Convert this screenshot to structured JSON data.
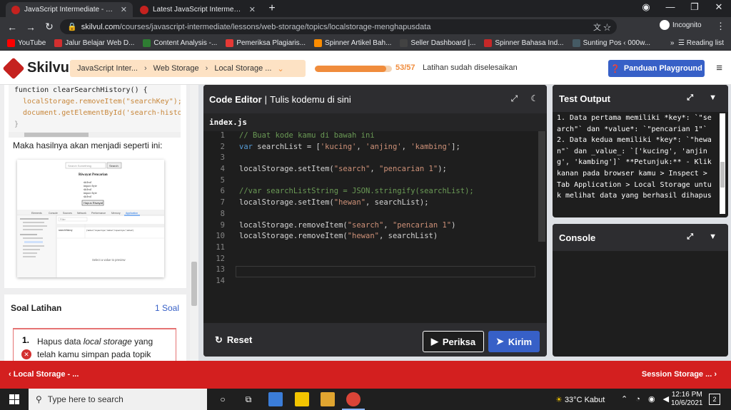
{
  "browser": {
    "tabs": [
      {
        "title": "JavaScript Intermediate - Web St",
        "close": "✕"
      },
      {
        "title": "Latest JavaScript Intermediate to",
        "close": "✕"
      }
    ],
    "new_tab": "+",
    "url_host": "skilvul.com",
    "url_path": "/courses/javascript-intermediate/lessons/web-storage/topics/localstorage-menghapusdata",
    "incognito": "Incognito",
    "bookmarks": [
      {
        "label": "YouTube",
        "color": "#ff0000"
      },
      {
        "label": "Jalur Belajar Web D...",
        "color": "#d32f2f"
      },
      {
        "label": "Content Analysis -...",
        "color": "#2e7d32"
      },
      {
        "label": "Pemeriksa Plagiaris...",
        "color": "#e53935"
      },
      {
        "label": "Spinner Artikel Bah...",
        "color": "#fb8c00"
      },
      {
        "label": "Seller Dashboard |...",
        "color": "#424242"
      },
      {
        "label": "Spinner Bahasa Ind...",
        "color": "#c62828"
      },
      {
        "label": "Sunting Pos ‹ 000w...",
        "color": "#455a64"
      }
    ],
    "bookmarks_more": "»",
    "reading_list": "Reading list"
  },
  "header": {
    "logo": "Skilvul",
    "breadcrumbs": [
      "JavaScript Inter...",
      "Web Storage",
      "Local Storage ..."
    ],
    "progress_fraction": 0.93,
    "progress_count": "53/57",
    "progress_text": "Latihan sudah diselesaikan",
    "guide_button": "Panduan Playground"
  },
  "lesson": {
    "code_lines": [
      "function clearSearchHistory() {",
      "  localStorage.removeItem(\"searchKey\");",
      "  document.getElementById('search-history",
      "}"
    ],
    "result_text": "Maka hasilnya akan menjadi seperti ini:",
    "figure": {
      "search_placeholder": "Search Something",
      "search_button": "Search",
      "history_title": "Riwayat Pencarian",
      "history_items": [
        "skilvul",
        "impact byte",
        "skilvul",
        "impact byte",
        "skilvul"
      ],
      "delete_button": "Hapus Riwayat",
      "devtools_tabs": [
        "Elements",
        "Console",
        "Sources",
        "Network",
        "Performance",
        "Memory",
        "Application"
      ],
      "devtools_filter": "Filter",
      "devtools_key": "searchHistory",
      "devtools_value": "[\"skilvul\",\"impact byte\",\"skilvul\",\"impact byte\",\"skilvul\"]",
      "devtools_select": "Select a value to preview"
    }
  },
  "soal": {
    "title": "Soal Latihan",
    "count": "1 Soal",
    "number": "1.",
    "text_before": "Hapus data ",
    "text_em": "local storage",
    "text_after": " yang telah kamu simpan pada topik"
  },
  "editor": {
    "title": "Code Editor",
    "subtitle": "Tulis kodemu di sini",
    "file": "index.js",
    "lines": [
      "1",
      "2",
      "3",
      "4",
      "5",
      "6",
      "7",
      "8",
      "9",
      "10",
      "11",
      "12",
      "13",
      "14"
    ],
    "reset": "Reset",
    "check": "Periksa",
    "submit": "Kirim"
  },
  "test_output": {
    "title": "Test Output",
    "text": "1. Data pertama memiliki *key*: `\"search\"` dan *value*: `\"pencarian 1\"` 2. Data kedua memiliki *key*: `\"hewan\"` dan _value_: `['kucing', 'anjing', 'kambing']` **Petunjuk:** - Klik kanan pada browser kamu > Inspect > Tab Application > Local Storage untuk melihat data yang berhasil dihapus"
  },
  "console": {
    "title": "Console"
  },
  "lesson_nav": {
    "prev": "‹ Local Storage - ...",
    "next": "Session Storage ... ›"
  },
  "taskbar": {
    "search_placeholder": "Type here to search",
    "weather": "33°C  Kabut",
    "time": "12:16 PM",
    "date": "10/6/2021",
    "notifications": "2"
  }
}
